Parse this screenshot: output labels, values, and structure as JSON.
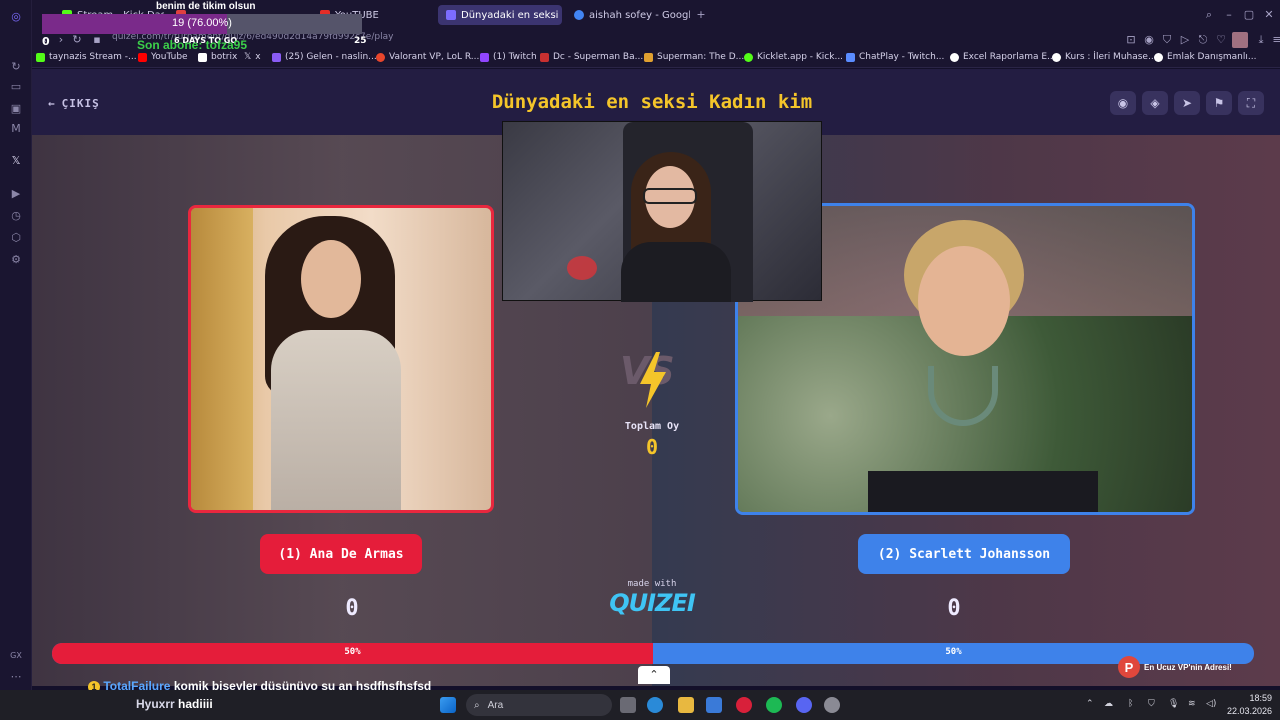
{
  "browser": {
    "tabs": [
      {
        "label": "Stream - Kick Dashboa",
        "color": "#53fc18"
      },
      {
        "label": "",
        "color": "#e04040"
      },
      {
        "label": "YouTUBE",
        "color": "#e52d27"
      },
      {
        "label": "Dünyadaki en seksi Kadın",
        "color": "#7c6cff"
      },
      {
        "label": "aishah sofey - Google'da A",
        "color": "#4285f4"
      }
    ],
    "url": "quizei.com/tr/turnament/quiz/6/ed490d2d14a79fd992c7e/play",
    "bookmarks": [
      {
        "label": "taynazis Stream -...",
        "color": "#53fc18"
      },
      {
        "label": "YouTube",
        "color": "#ff0000"
      },
      {
        "label": "botrix",
        "color": "#ffffff"
      },
      {
        "label": "x",
        "color": "#ffffff"
      },
      {
        "label": "(25) Gelen - naslin...",
        "color": "#8a5cf5"
      },
      {
        "label": "Valorant VP, LoL R...",
        "color": "#e8462c"
      },
      {
        "label": "(1) Twitch",
        "color": "#9146ff"
      },
      {
        "label": "Dc - Superman Ba...",
        "color": "#c83030"
      },
      {
        "label": "Superman: The D...",
        "color": "#e0a030"
      },
      {
        "label": "Kicklet.app - Kick...",
        "color": "#53fc18"
      },
      {
        "label": "ChatPlay - Twitch...",
        "color": "#5a8cff"
      },
      {
        "label": "Excel Raporlama E...",
        "color": "#ffffff"
      },
      {
        "label": "Kurs : İleri Muhase...",
        "color": "#ffffff"
      },
      {
        "label": "Emlak Danışmanlı...",
        "color": "#ffffff"
      }
    ]
  },
  "overlay": {
    "top_text": "benim de tikim olsun",
    "goal_text": "19 (76.00%)",
    "goal_progress": 0.76,
    "goal_start": "0",
    "goal_days": "6 DAYS TO GO",
    "goal_end": "25",
    "last_sub": "Son abone: tofza95"
  },
  "quiz": {
    "exit_label": "ÇIKIŞ",
    "title": "Dünyadaki en seksi Kadın kim",
    "total_label": "Toplam Oy",
    "total_votes": "0",
    "left": {
      "name": "(1) Ana De Armas",
      "votes": "0",
      "percent_label": "50%",
      "share": 0.5
    },
    "right": {
      "name": "(2) Scarlett Johansson",
      "votes": "0",
      "percent_label": "50%"
    },
    "made_with": "made with",
    "brand": "QUIZEI",
    "colors": {
      "left": "#e51d3a",
      "right": "#3e82ea",
      "title": "#f4c52a"
    }
  },
  "ad_text": "En Ucuz VP'nin Adresi!",
  "chat": [
    {
      "user": "TotalFailure",
      "message": "komik bişeyler düşünüyo şu an hsdfhsfhsfsd"
    },
    {
      "user": "Hyuxrr",
      "message": "hadiiii"
    }
  ],
  "taskbar": {
    "search_placeholder": "Ara",
    "time": "18:59",
    "date": "22.03.2026"
  }
}
